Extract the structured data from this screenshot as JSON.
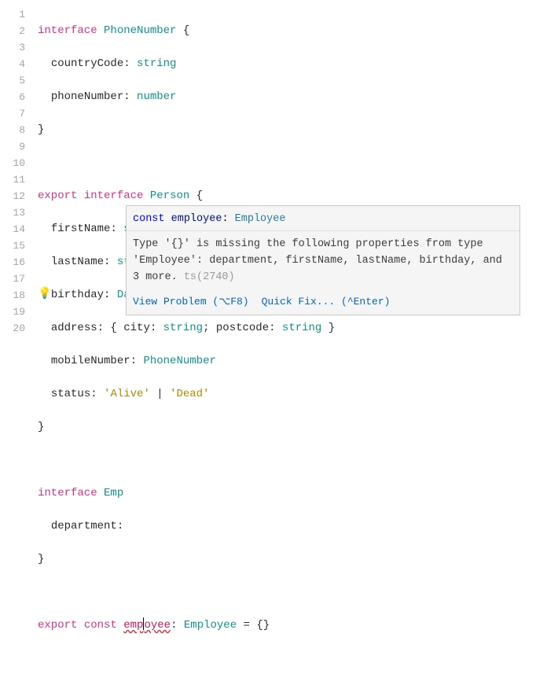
{
  "gutter": {
    "lines": [
      "1",
      "2",
      "3",
      "4",
      "5",
      "6",
      "7",
      "8",
      "9",
      "10",
      "11",
      "12",
      "13",
      "14",
      "15",
      "16",
      "17",
      "18",
      "19",
      "20"
    ]
  },
  "code": {
    "l1": {
      "kw": "interface",
      "name": "PhoneNumber",
      "brace": " {"
    },
    "l2": {
      "prop": "countryCode",
      "colon": ": ",
      "type": "string"
    },
    "l3": {
      "prop": "phoneNumber",
      "colon": ": ",
      "type": "number"
    },
    "l4": {
      "brace": "}"
    },
    "l6": {
      "export": "export",
      "kw": "interface",
      "name": "Person",
      "brace": " {"
    },
    "l7": {
      "prop": "firstName",
      "colon": ": ",
      "type": "string"
    },
    "l8": {
      "prop": "lastName",
      "colon": ": ",
      "type": "string"
    },
    "l9": {
      "prop": "birthday",
      "colon": ": ",
      "type": "Date"
    },
    "l10": {
      "prop": "address",
      "colon": ": { ",
      "p1": "city",
      "c1": ": ",
      "t1": "string",
      "semi": "; ",
      "p2": "postcode",
      "c2": ": ",
      "t2": "string",
      "end": " }"
    },
    "l11": {
      "prop": "mobileNumber",
      "colon": ": ",
      "type": "PhoneNumber"
    },
    "l12": {
      "prop": "status",
      "colon": ": ",
      "s1": "'Alive'",
      "pipe": " | ",
      "s2": "'Dead'"
    },
    "l13": {
      "brace": "}"
    },
    "l15": {
      "kw": "interface",
      "name": "Emp"
    },
    "l16": {
      "prop": "department",
      "colon": ":"
    },
    "l17": {
      "brace": "}"
    },
    "l19": {
      "export": "export",
      "const": "const",
      "varpre": "emp",
      "varpost": "oyee",
      "colon": ": ",
      "type": "Employee",
      "eq": " = {}"
    }
  },
  "tooltip": {
    "sig": {
      "kw": "const",
      "name": "employee",
      "colon": ": ",
      "type": "Employee"
    },
    "msg": "Type '{}' is missing the following properties from type 'Employee': department, firstName, lastName, birthday, and 3 more.",
    "errcode": "ts(2740)",
    "viewProblem": "View Problem (⌥F8)",
    "quickFix": "Quick Fix... (^Enter)"
  },
  "bulb": "💡"
}
